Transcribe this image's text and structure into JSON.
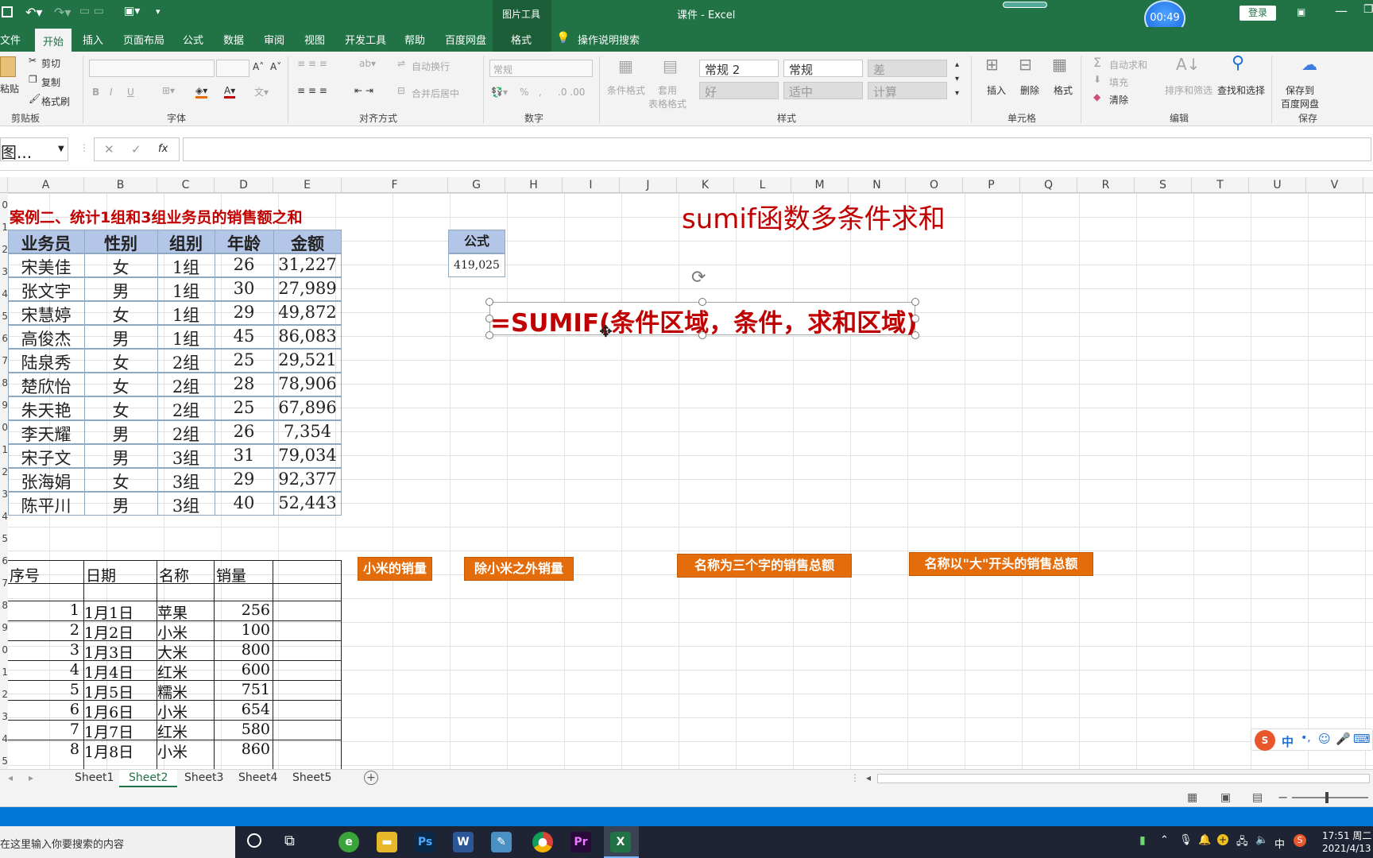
{
  "titlebar": {
    "context_tool": "图片工具",
    "title": "课件  -  Excel",
    "login": "登录",
    "timer": "00:49"
  },
  "tabs": [
    "文件",
    "开始",
    "插入",
    "页面布局",
    "公式",
    "数据",
    "审阅",
    "视图",
    "开发工具",
    "帮助",
    "百度网盘",
    "格式",
    "操作说明搜索"
  ],
  "ribbon": {
    "clipboard": {
      "cut": "剪切",
      "copy": "复制",
      "format_painter": "格式刷",
      "paste": "粘贴",
      "label": "剪贴板"
    },
    "font": {
      "label": "字体",
      "bold": "B",
      "italic": "I",
      "underline": "U"
    },
    "align": {
      "wrap": "自动换行",
      "merge": "合并后居中",
      "label": "对齐方式"
    },
    "number": {
      "format": "常规",
      "percent": "%",
      "comma": ",",
      "label": "数字"
    },
    "styles": {
      "cond": "条件格式",
      "table": "套用\n表格格式",
      "label": "样式",
      "boxes": [
        "常规 2",
        "常规",
        "差",
        "好",
        "适中",
        "计算"
      ]
    },
    "cells": {
      "insert": "插入",
      "delete": "删除",
      "format": "格式",
      "label": "单元格"
    },
    "editing": {
      "autosum": "自动求和",
      "fill": "填充",
      "clear": "清除",
      "sort": "排序和筛选",
      "find": "查找和选择",
      "label": "编辑"
    },
    "save": {
      "btn": "保存到\n百度网盘",
      "label": "保存"
    }
  },
  "formula": {
    "namebox": "图...",
    "value": ""
  },
  "columns": [
    "A",
    "B",
    "C",
    "D",
    "E",
    "F",
    "G",
    "H",
    "I",
    "J",
    "K",
    "L",
    "M",
    "N",
    "O",
    "P",
    "Q",
    "R",
    "S",
    "T",
    "U",
    "V"
  ],
  "row_numbers": [
    "0",
    "1",
    "2",
    "3",
    "4",
    "5",
    "6",
    "7",
    "8",
    "9",
    "0",
    "1",
    "2",
    "3",
    "4",
    "5",
    "6",
    "7",
    "8",
    "9",
    "0",
    "1",
    "2",
    "3",
    "4",
    "5"
  ],
  "case_title": "案例二、统计1组和3组业务员的销售额之和",
  "main_title": "sumif函数多条件求和",
  "table1": {
    "headers": [
      "业务员",
      "性别",
      "组别",
      "年龄",
      "金额"
    ],
    "rows": [
      [
        "宋美佳",
        "女",
        "1组",
        "26",
        "31,227"
      ],
      [
        "张文宇",
        "男",
        "1组",
        "30",
        "27,989"
      ],
      [
        "宋慧婷",
        "女",
        "1组",
        "29",
        "49,872"
      ],
      [
        "高俊杰",
        "男",
        "1组",
        "45",
        "86,083"
      ],
      [
        "陆泉秀",
        "女",
        "2组",
        "25",
        "29,521"
      ],
      [
        "楚欣怡",
        "女",
        "2组",
        "28",
        "78,906"
      ],
      [
        "朱天艳",
        "女",
        "2组",
        "25",
        "67,896"
      ],
      [
        "李天耀",
        "男",
        "2组",
        "26",
        "7,354"
      ],
      [
        "宋子文",
        "男",
        "3组",
        "31",
        "79,034"
      ],
      [
        "张海娟",
        "女",
        "3组",
        "29",
        "92,377"
      ],
      [
        "陈平川",
        "男",
        "3组",
        "40",
        "52,443"
      ]
    ]
  },
  "formula_box": {
    "header": "公式",
    "value": "419,025"
  },
  "formula_text": "=SUMIF(条件区域，条件，求和区域)",
  "table2": {
    "headers": [
      "序号",
      "日期",
      "名称",
      "销量"
    ],
    "rows": [
      [
        "1",
        "1月1日",
        "苹果",
        "256"
      ],
      [
        "2",
        "1月2日",
        "小米",
        "100"
      ],
      [
        "3",
        "1月3日",
        "大米",
        "800"
      ],
      [
        "4",
        "1月4日",
        "红米",
        "600"
      ],
      [
        "5",
        "1月5日",
        "糯米",
        "751"
      ],
      [
        "6",
        "1月6日",
        "小米",
        "654"
      ],
      [
        "7",
        "1月7日",
        "红米",
        "580"
      ],
      [
        "8",
        "1月8日",
        "小米",
        "860"
      ]
    ]
  },
  "buttons": [
    "小米的销量",
    "除小米之外销量",
    "名称为三个字的销售总额",
    "名称以\"大\"开头的销售总额"
  ],
  "sheets": [
    "Sheet1",
    "Sheet2",
    "Sheet3",
    "Sheet4",
    "Sheet5"
  ],
  "active_sheet": "Sheet2",
  "taskbar": {
    "search": "在这里输入你要搜索的内容",
    "time": "17:51 周二",
    "date": "2021/4/13",
    "ime": "中"
  },
  "ime_bar": {
    "lang": "中"
  },
  "colors": {
    "excel_green": "#217346",
    "title_red": "#c00000",
    "header_blue": "#b4c6e7",
    "button_orange": "#e46c0a"
  }
}
